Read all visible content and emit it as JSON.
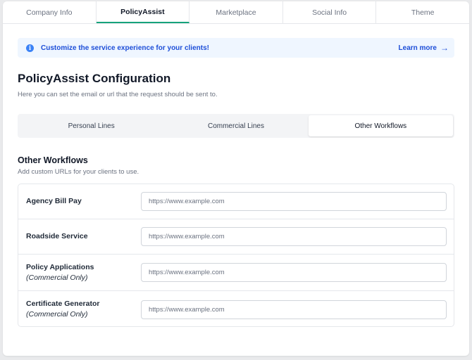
{
  "tabs": [
    {
      "label": "Company Info",
      "active": false
    },
    {
      "label": "PolicyAssist",
      "active": true
    },
    {
      "label": "Marketplace",
      "active": false
    },
    {
      "label": "Social Info",
      "active": false
    },
    {
      "label": "Theme",
      "active": false
    }
  ],
  "banner": {
    "icon": "info-icon",
    "text": "Customize the service experience for your clients!",
    "link_label": "Learn more",
    "link_icon": "arrow-right-icon"
  },
  "page": {
    "title": "PolicyAssist Configuration",
    "subtitle": "Here you can set the email or url that the request should be sent to."
  },
  "segments": [
    {
      "label": "Personal Lines",
      "active": false
    },
    {
      "label": "Commercial Lines",
      "active": false
    },
    {
      "label": "Other Workflows",
      "active": true
    }
  ],
  "section": {
    "title": "Other Workflows",
    "subtitle": "Add custom URLs for your clients to use."
  },
  "rows": [
    {
      "label": "Agency Bill Pay",
      "note": "",
      "value": "",
      "placeholder": "https://www.example.com"
    },
    {
      "label": "Roadside Service",
      "note": "",
      "value": "",
      "placeholder": "https://www.example.com"
    },
    {
      "label": "Policy Applications",
      "note": "(Commercial Only)",
      "value": "",
      "placeholder": "https://www.example.com"
    },
    {
      "label": "Certificate Generator",
      "note": "(Commercial Only)",
      "value": "",
      "placeholder": "https://www.example.com"
    }
  ],
  "colors": {
    "accent": "#16a37b",
    "info_blue": "#1d4ed8",
    "banner_bg": "#eff6ff"
  }
}
